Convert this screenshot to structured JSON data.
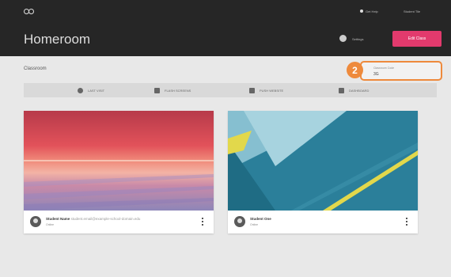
{
  "header": {
    "title": "Homeroom",
    "help_label": "Get Help",
    "account_label": "Student Tile",
    "settings_label": "Settings",
    "primary_button": "Edit Class"
  },
  "page": {
    "heading": "Classroom"
  },
  "classroom_code": {
    "label": "Classroom Code",
    "value": "3G",
    "step_badge": "2"
  },
  "tabs": [
    {
      "label": "LAST VISIT",
      "icon": "clock-icon"
    },
    {
      "label": "FLASH SCREENS",
      "icon": "screen-icon"
    },
    {
      "label": "PUSH WEBSITE",
      "icon": "link-icon"
    },
    {
      "label": "DASHBOARD",
      "icon": "grid-icon"
    }
  ],
  "students": [
    {
      "name": "Student Name",
      "email": "student.email@example-school-domain.edu",
      "status": "Online",
      "image": "sunset-lake"
    },
    {
      "name": "Student One",
      "email": "",
      "status": "Online",
      "image": "material-geometric"
    }
  ],
  "colors": {
    "accent_pink": "#e23a6d",
    "highlight_orange": "#ee8a3c",
    "header_bg": "#262626"
  }
}
